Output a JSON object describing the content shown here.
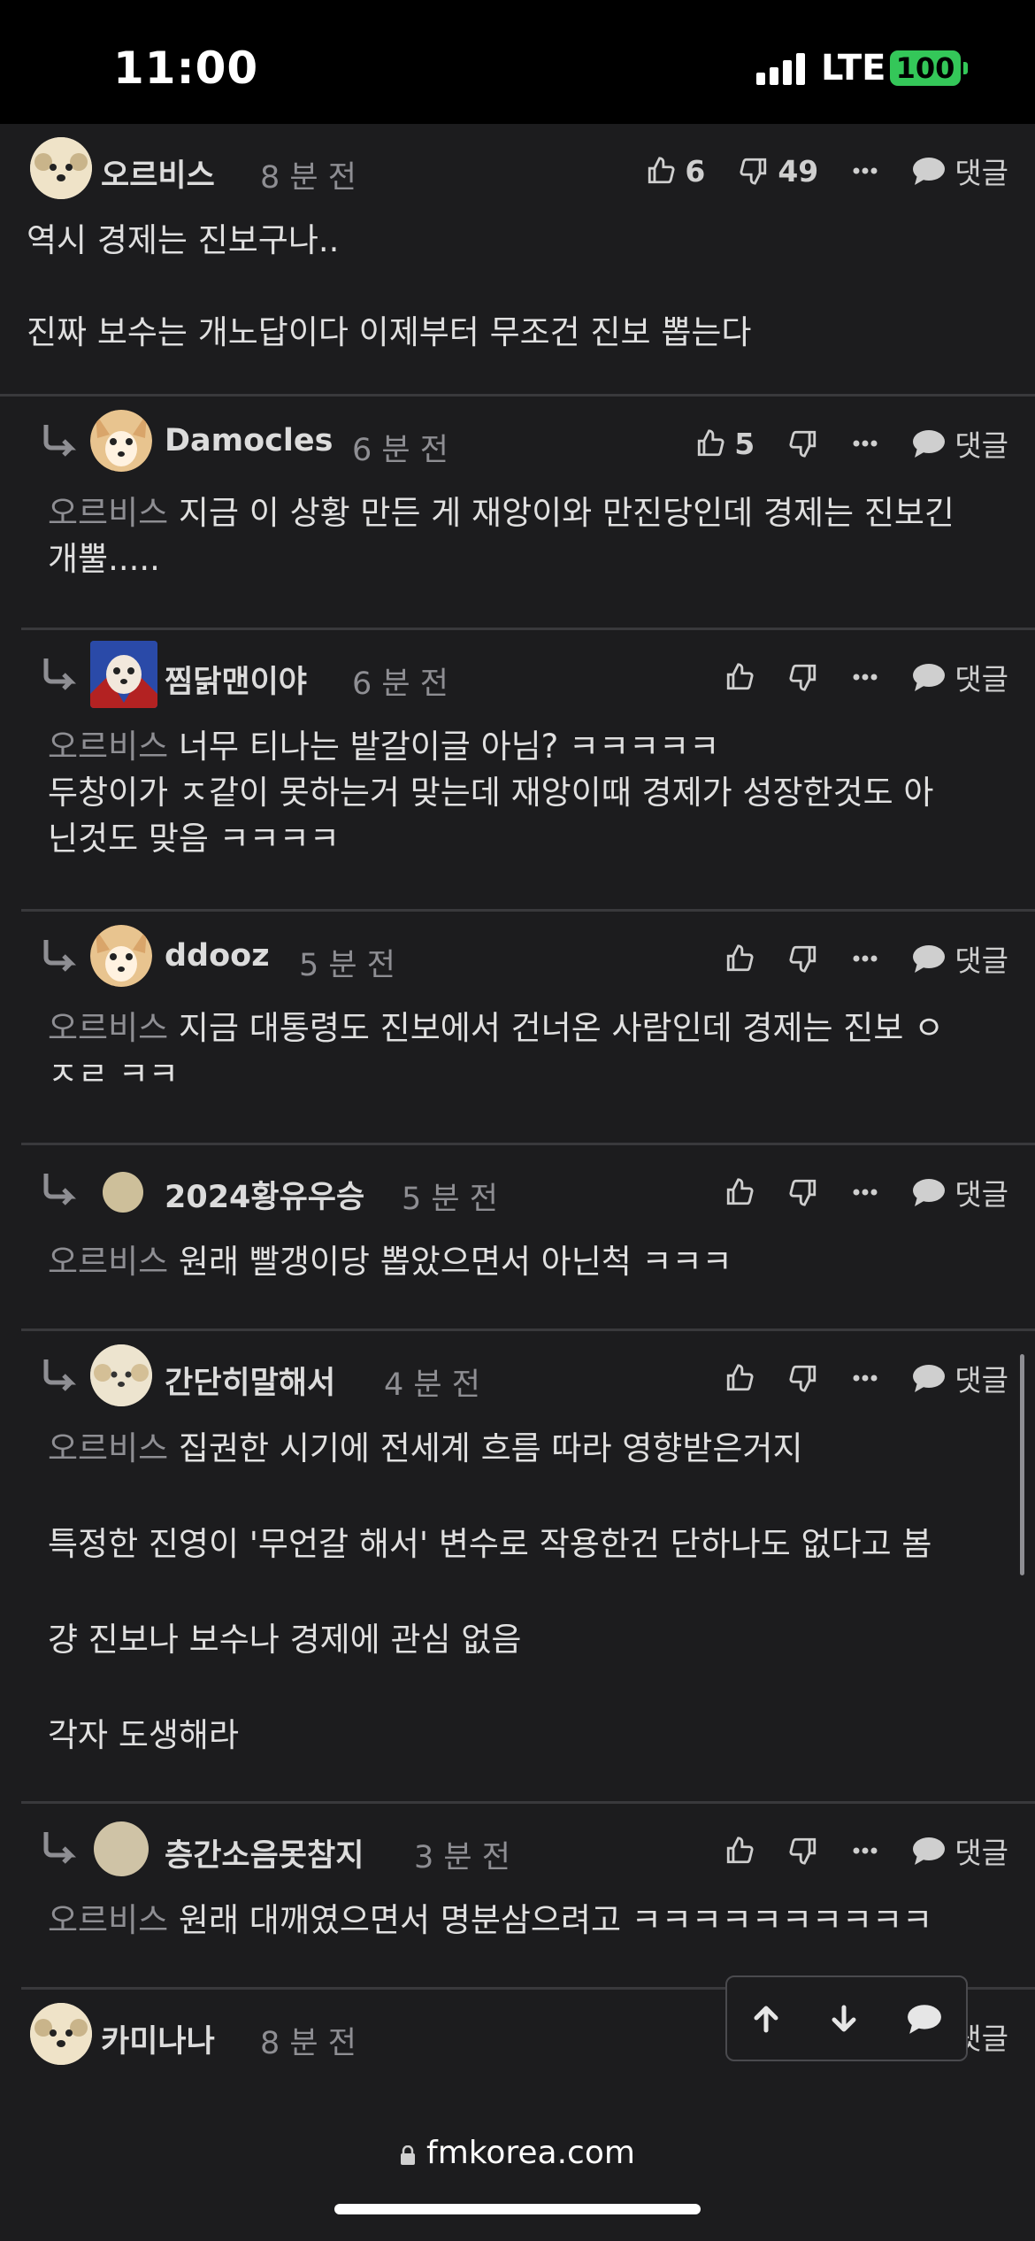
{
  "status": {
    "time": "11:00",
    "network": "LTE",
    "battery": "100"
  },
  "comments": [
    {
      "author": "오르비스",
      "time": "8 분 전",
      "likes": "6",
      "dislikes": "49",
      "reply_label": "댓글",
      "mention": "",
      "body": "역시 경제는 진보구나..\n\n진짜 보수는 개노답이다 이제부터 무조건 진보 뽑는다"
    },
    {
      "author": "Damocles",
      "time": "6 분 전",
      "likes": "5",
      "dislikes": "",
      "reply_label": "댓글",
      "mention": "오르비스",
      "body": " 지금 이 상황 만든 게 재앙이와 만진당인데 경제는 진보긴\n개뿔....."
    },
    {
      "author": "찜닭맨이야",
      "time": "6 분 전",
      "likes": "",
      "dislikes": "",
      "reply_label": "댓글",
      "mention": "오르비스",
      "body": " 너무 티나는 밭갈이글 아님? ㅋㅋㅋㅋㅋ\n두창이가 ㅈ같이 못하는거 맞는데 재앙이때 경제가 성장한것도 아\n닌것도 맞음 ㅋㅋㅋㅋ"
    },
    {
      "author": "ddooz",
      "time": "5 분 전",
      "likes": "",
      "dislikes": "",
      "reply_label": "댓글",
      "mention": "오르비스",
      "body": " 지금 대통령도 진보에서 건너온 사람인데 경제는 진보 ㅇ\nㅈㄹ ㅋㅋ"
    },
    {
      "author": "2024황유우승",
      "time": "5 분 전",
      "likes": "",
      "dislikes": "",
      "reply_label": "댓글",
      "mention": "오르비스",
      "body": " 원래 빨갱이당 뽑았으면서 아닌척 ㅋㅋㅋ"
    },
    {
      "author": "간단히말해서",
      "time": "4 분 전",
      "likes": "",
      "dislikes": "",
      "reply_label": "댓글",
      "mention": "오르비스",
      "body": " 집권한 시기에 전세계 흐름 따라 영향받은거지\n\n특정한 진영이 '무언갈 해서' 변수로 작용한건 단하나도 없다고 봄\n\n걍 진보나 보수나 경제에 관심 없음\n\n각자 도생해라"
    },
    {
      "author": "층간소음못참지",
      "time": "3 분 전",
      "likes": "",
      "dislikes": "",
      "reply_label": "댓글",
      "mention": "오르비스",
      "body": " 원래 대깨였으면서 명분삼으려고 ㅋㅋㅋㅋㅋㅋㅋㅋㅋㅋ"
    },
    {
      "author": "카미나나",
      "time": "8 분 전",
      "likes": "",
      "dislikes": "",
      "reply_label": "댓글",
      "mention": "",
      "body": ""
    }
  ],
  "url": "fmkorea.com",
  "icons": {
    "like": "thumbs-up-icon",
    "dislike": "thumbs-down-icon",
    "more": "more-icon",
    "reply": "speech-bubble-icon",
    "up": "arrow-up-icon",
    "down": "arrow-down-icon",
    "lock": "lock-icon"
  }
}
